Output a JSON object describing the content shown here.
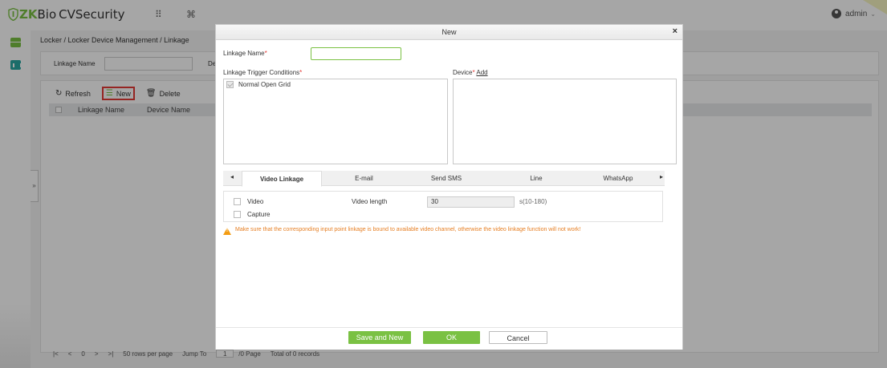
{
  "app": {
    "brand_prefix": "ZK",
    "brand_main": "Bio",
    "brand_suffix": "CVSecurity",
    "grid_icon_glyph": "⠿",
    "cmd_icon_glyph": "⌘",
    "user": "admin",
    "accent_color": "#7ac143"
  },
  "page": {
    "breadcrumb": "Locker / Locker Device Management / Linkage",
    "search": {
      "linkage_name_label": "Linkage Name",
      "device_label_partial": "Devic"
    },
    "toolbar": {
      "refresh": "Refresh",
      "new": "New",
      "delete": "Delete"
    },
    "grid_columns": [
      "Linkage Name",
      "Device Name"
    ],
    "side_toggle": "»",
    "pager": {
      "first": "|<",
      "prev": "<",
      "current": "0",
      "next": ">",
      "last": ">|",
      "rows_per_page": "50 rows per page",
      "jump_to": "Jump To",
      "jump_value": "1",
      "page_text": "/0 Page",
      "total": "Total of 0 records"
    }
  },
  "dialog": {
    "title": "New",
    "close": "×",
    "linkage_name_label": "Linkage Name",
    "trigger_label": "Linkage Trigger Conditions",
    "trigger_items": [
      "Normal Open Grid"
    ],
    "device_label": "Device",
    "device_add": "Add",
    "tabs": [
      "Video Linkage",
      "E-mail",
      "Send SMS",
      "Line",
      "WhatsApp"
    ],
    "tab_prev": "◂",
    "tab_next": "▸",
    "video": {
      "video_label": "Video",
      "capture_label": "Capture",
      "video_length_label": "Video length",
      "video_length_value": "30",
      "video_length_hint": "s(10-180)"
    },
    "warning": "Make sure that the corresponding input point linkage is bound to available video channel, otherwise the video linkage function will not work!",
    "buttons": {
      "save_and_new": "Save and New",
      "ok": "OK",
      "cancel": "Cancel"
    }
  }
}
